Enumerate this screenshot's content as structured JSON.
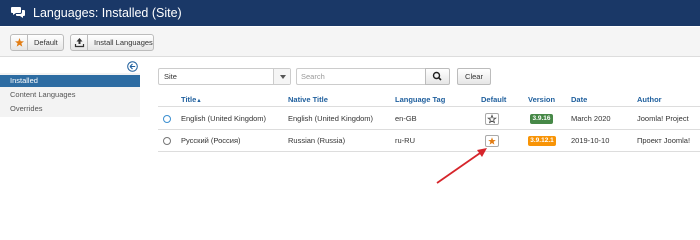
{
  "header": {
    "title": "Languages: Installed (Site)",
    "icon": "comments-icon",
    "bg_color": "#1a3867"
  },
  "toolbar": {
    "default_label": "Default",
    "default_icon": "star-icon",
    "install_label": "Install Languages",
    "install_icon": "upload-icon"
  },
  "sidebar": {
    "items": [
      {
        "label": "Installed",
        "active": true
      },
      {
        "label": "Content Languages",
        "active": false
      },
      {
        "label": "Overrides",
        "active": false
      }
    ]
  },
  "filters": {
    "client_select": "Site",
    "search_placeholder": "Search",
    "search_icon": "search-icon",
    "clear_label": "Clear"
  },
  "table": {
    "headers": [
      "Title",
      "Native Title",
      "Language Tag",
      "Default",
      "Version",
      "Date",
      "Author"
    ],
    "sort_indicator": "▲",
    "rows": [
      {
        "title": "English (United Kingdom)",
        "native_title": "English (United Kingdom)",
        "tag": "en-GB",
        "is_default": true,
        "version": "3.9.16",
        "version_color": "#468847",
        "date": "March 2020",
        "author": "Joomla! Project"
      },
      {
        "title": "Русский (Россия)",
        "native_title": "Russian (Russia)",
        "tag": "ru-RU",
        "is_default": false,
        "version": "3.9.12.1",
        "version_color": "#f89406",
        "date": "2019-10-10",
        "author": "Проект Joomla!"
      }
    ]
  },
  "annotation": {
    "type": "arrow",
    "color": "#d6252b"
  }
}
